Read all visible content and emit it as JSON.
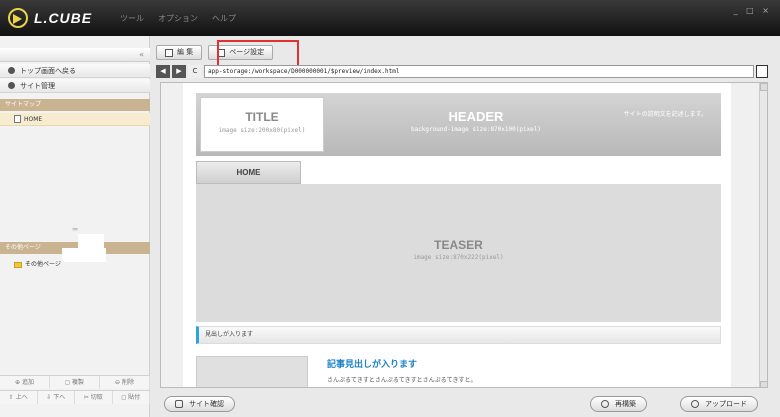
{
  "app": {
    "logo_text": "L.CUBE",
    "menu": [
      "ツール",
      "オプション",
      "ヘルプ"
    ],
    "window_controls": "_ □ ×"
  },
  "sidebar": {
    "collapse": "«",
    "back_top": "トップ画面へ戻る",
    "site_manage": "サイト管理",
    "sitemap_header": "サイトマップ",
    "sitemap_item": "HOME",
    "splitter": "═",
    "other_header": "その他ページ",
    "other_item": "その他ページ",
    "actions_row1": [
      "⊕ 追加",
      "◻ 複製",
      "⊖ 削除"
    ],
    "actions_row2": [
      "⇧ 上へ",
      "⇩ 下へ",
      "✂ 切取",
      "◻ 貼付"
    ]
  },
  "toolbar": {
    "edit_label": "編 集",
    "page_settings_label": "ページ設定"
  },
  "addressbar": {
    "back": "◀",
    "forward": "▶",
    "reload": "C",
    "url": "app-storage:/workspace/D000000001/$preview/index.html"
  },
  "preview": {
    "title_big": "TITLE",
    "title_small": "image size:200x80(pixel)",
    "header_big": "HEADER",
    "header_small": "background-image size:870x100(pixel)",
    "site_desc": "サイトの説明文を記述します。",
    "home_tab": "HOME",
    "teaser_big": "TEASER",
    "teaser_small": "image size:870x222(pixel)",
    "h2_text": "見出しが入ります",
    "article_title": "記事見出しが入ります",
    "article_body": "さんぷるてきすとさんぷるてきすとさんぷるてきすと。"
  },
  "bottom": {
    "site_check": "サイト確認",
    "rebuild": "再構築",
    "upload": "アップロード"
  },
  "colors": {
    "highlight": "#e53030",
    "accent_blue": "#1a83c7",
    "sidebar_header": "#c9b390"
  }
}
